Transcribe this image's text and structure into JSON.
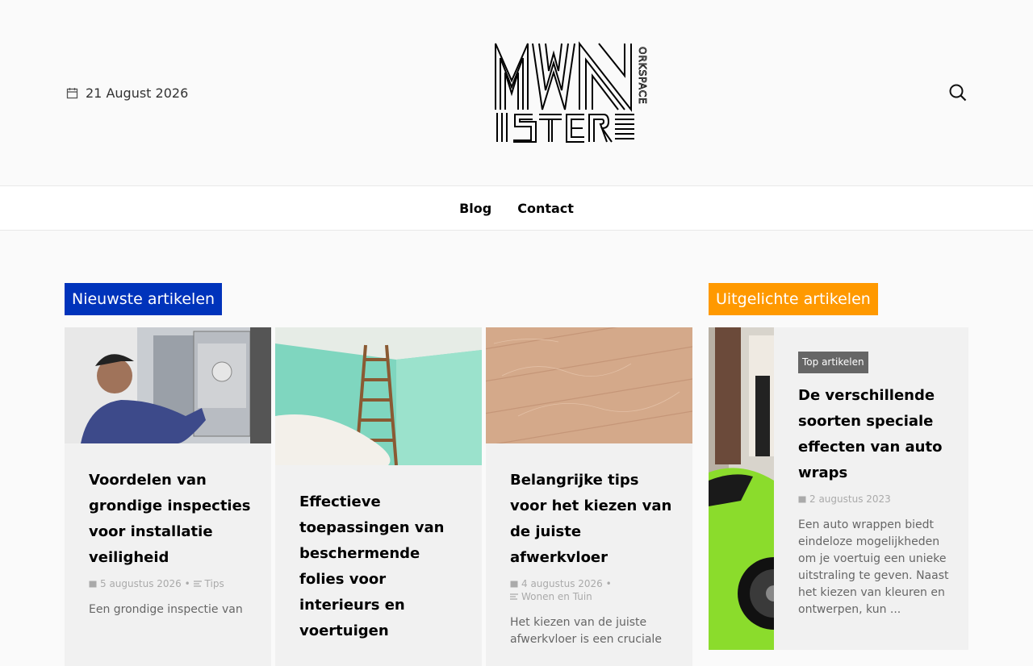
{
  "header": {
    "date": "21 August 2026",
    "logo_text": "MWISTER ORKSPACE"
  },
  "nav": {
    "items": [
      "Blog",
      "Contact"
    ]
  },
  "sections": {
    "latest": "Nieuwste artikelen",
    "featured": "Uitgelichte artikelen"
  },
  "cards": [
    {
      "title": "Voordelen van grondige inspecties voor installatie veiligheid",
      "date": "5 augustus 2026",
      "category": "Tips",
      "excerpt": "Een grondige inspectie van"
    },
    {
      "title": "Effectieve toepassingen van beschermende folies voor interieurs en voertuigen",
      "date": "",
      "category": "",
      "excerpt": ""
    },
    {
      "title": "Belangrijke tips voor het kiezen van de juiste afwerkvloer",
      "date": "4 augustus 2026",
      "category": "Wonen en Tuin",
      "excerpt": "Het kiezen van de juiste afwerkvloer is een cruciale"
    }
  ],
  "featured": {
    "badge": "Top artikelen",
    "title": "De verschillende soorten speciale effecten van auto wraps",
    "date": "2 augustus 2023",
    "excerpt": "Een auto wrappen biedt eindeloze mogelijkheden om je voertuig een unieke uitstraling te geven. Naast het kiezen van kleuren en ontwerpen, kun ..."
  },
  "colors": {
    "blue": "#0033bb",
    "orange": "#ff9900"
  }
}
